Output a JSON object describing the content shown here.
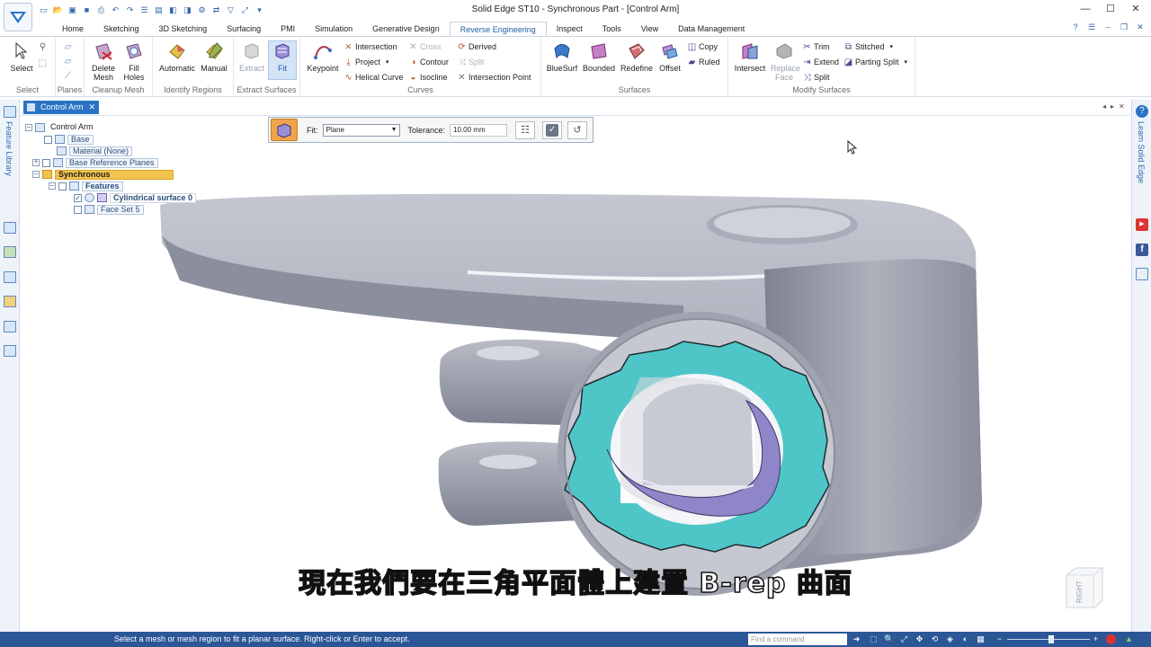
{
  "window": {
    "title": "Solid Edge ST10 - Synchronous Part - [Control Arm]",
    "controls": [
      "—",
      "☐",
      "✕"
    ]
  },
  "ribbon_tabs": [
    "Home",
    "Sketching",
    "3D Sketching",
    "Surfacing",
    "PMI",
    "Simulation",
    "Generative Design",
    "Reverse Engineering",
    "Inspect",
    "Tools",
    "View",
    "Data Management"
  ],
  "active_tab": "Reverse Engineering",
  "ribbon": {
    "select": {
      "label": "Select",
      "group": "Select"
    },
    "planes": {
      "group": "Planes"
    },
    "cleanup": {
      "delete_mesh": "Delete Mesh",
      "fill_holes": "Fill Holes",
      "group": "Cleanup Mesh"
    },
    "identify": {
      "automatic": "Automatic",
      "manual": "Manual",
      "group": "Identify Regions"
    },
    "extract": {
      "extract": "Extract",
      "fit": "Fit",
      "group": "Extract Surfaces"
    },
    "curves": {
      "keypoint": "Keypoint",
      "intersection": "Intersection",
      "cross": "Cross",
      "derived": "Derived",
      "project": "Project",
      "contour": "Contour",
      "split": "Split",
      "helical_curve": "Helical Curve",
      "isocline": "Isocline",
      "intersection_point": "Intersection Point",
      "group": "Curves"
    },
    "surfaces": {
      "bluesurf": "BlueSurf",
      "bounded": "Bounded",
      "redefine": "Redefine",
      "offset": "Offset",
      "copy": "Copy",
      "ruled": "Ruled",
      "group": "Surfaces"
    },
    "modify": {
      "intersect": "Intersect",
      "replace_face": "Replace Face",
      "trim": "Trim",
      "extend": "Extend",
      "split": "Split",
      "stitched": "Stitched",
      "parting_split": "Parting Split",
      "group": "Modify Surfaces"
    }
  },
  "document_tab": "Control Arm",
  "left_panel_label": "Feature Library",
  "right_panel_label": "Learn Solid Edge",
  "tree": {
    "root": "Control Arm",
    "base": "Base",
    "material": "Material (None)",
    "ref_planes": "Base Reference Planes",
    "synchronous": "Synchronous",
    "features": "Features",
    "cyl_surface": "Cylindrical surface 0",
    "face_set": "Face Set 5"
  },
  "command_bar": {
    "fit_label": "Fit:",
    "fit_value": "Plane",
    "tolerance_label": "Tolerance:",
    "tolerance_value": "10.00 mm"
  },
  "subtitle": "現在我們要在三角平面體上建置 B-rep 曲面",
  "view_cube_label": "RIGHT",
  "status": {
    "message": "Select a mesh or mesh region to fit a planar surface. Right-click or Enter to accept.",
    "find_placeholder": "Find a command"
  },
  "colors": {
    "accent": "#2a73c4",
    "status_bar": "#2b5797",
    "mesh_gray": "#9ea2ae",
    "region_cyan": "#4ec6c8",
    "region_purple": "#8f86c9",
    "highlight": "#f2c34e"
  }
}
